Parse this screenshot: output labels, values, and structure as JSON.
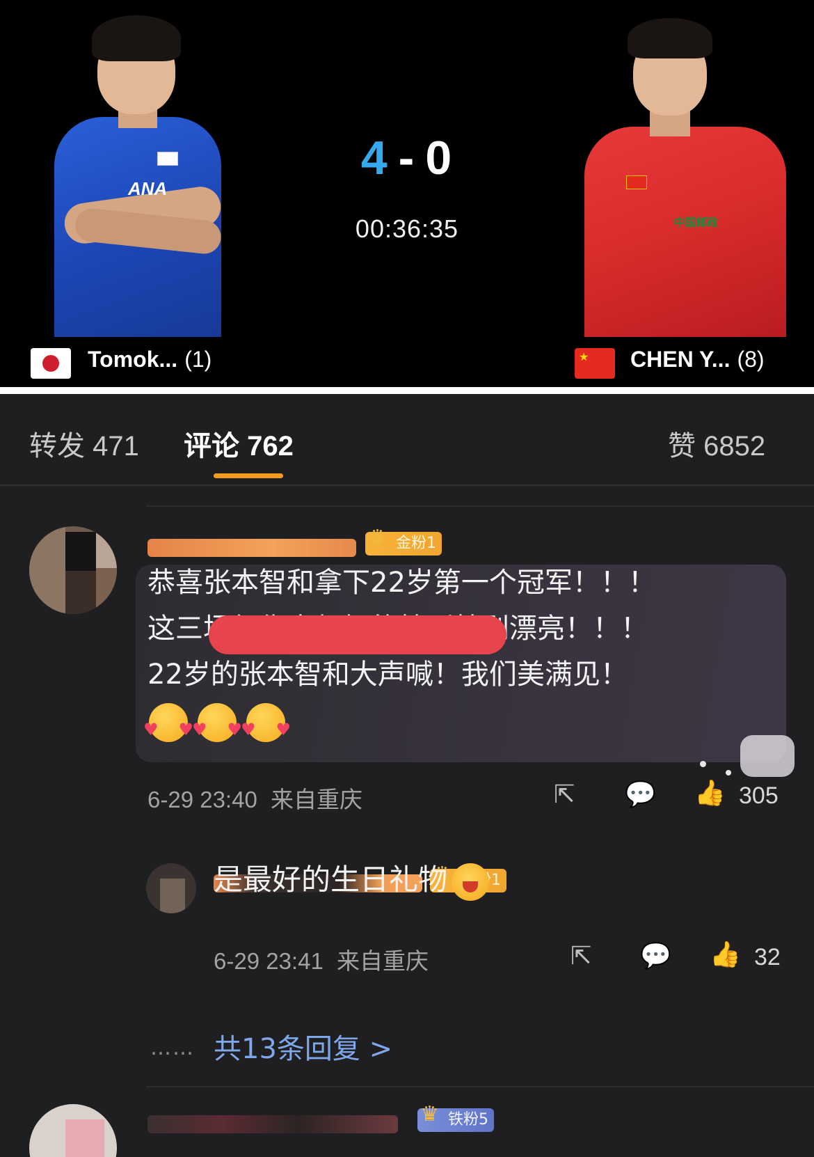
{
  "match": {
    "score_left": "4",
    "score_dash": "-",
    "score_right": "0",
    "time": "00:36:35",
    "player_left": {
      "name": "Tomok...",
      "seed": "(1)",
      "flag": "japan-flag"
    },
    "player_right": {
      "name": "CHEN Y...",
      "seed": "(8)",
      "flag": "china-flag"
    },
    "colors": {
      "score_accent": "#35a9ec",
      "left_shirt": "#1d46b4",
      "right_shirt": "#d82b2b"
    }
  },
  "tabs": {
    "repost": "转发 471",
    "comments": "评论 762",
    "likes": "赞 6852"
  },
  "comment1": {
    "badge": "金粉1",
    "lines": [
      "恭喜张本智和拿下22岁第一个冠军！！！",
      "这三场复仇赛都打的特别特别漂亮！！！",
      "22岁的张本智和大声喊！我们美满见！"
    ],
    "time": "6-29 23:40",
    "location": "来自重庆",
    "likes": "305"
  },
  "reply1": {
    "badge": "金粉1",
    "text": "是最好的生日礼物",
    "time": "6-29 23:41",
    "location": "来自重庆",
    "likes": "32"
  },
  "more": {
    "dots": "……",
    "label": "共13条回复 >"
  },
  "comment2": {
    "badge": "铁粉5"
  },
  "accent": {
    "tab_underline": "#f29b1f",
    "link": "#7fa8ea"
  }
}
